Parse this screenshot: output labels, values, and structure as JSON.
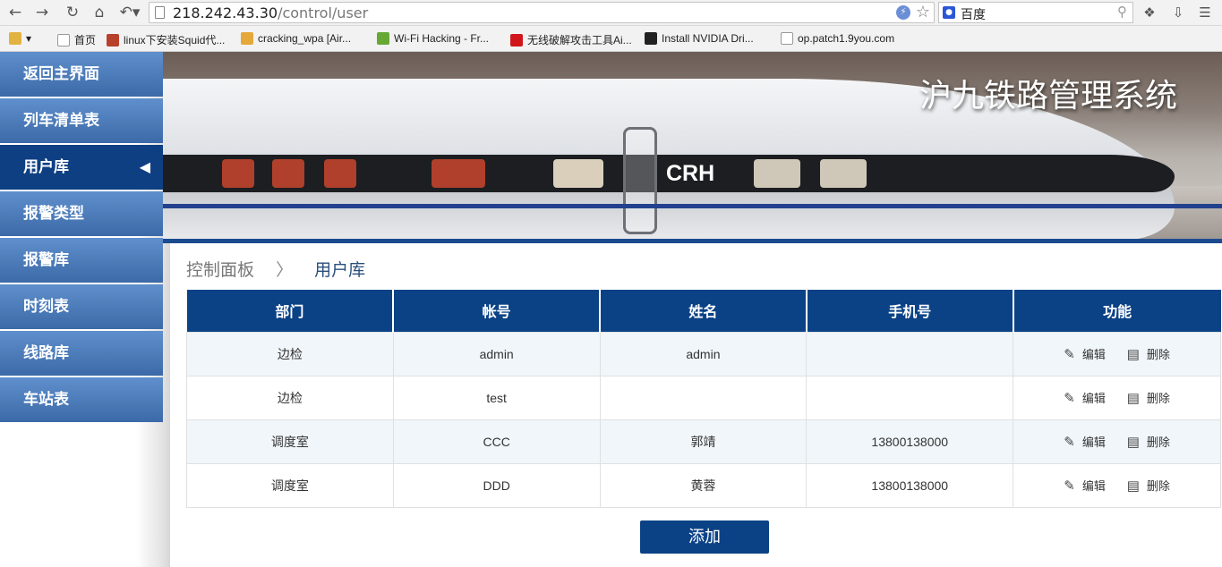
{
  "browser": {
    "url_host": "218.242.43.30",
    "url_path": "/control/user",
    "search_engine": "百度",
    "bookmarks": [
      {
        "label": "首页",
        "color": "#ffffff"
      },
      {
        "label": "linux下安装Squid代...",
        "color": "#b8412b"
      },
      {
        "label": "cracking_wpa [Air...",
        "color": "#e5a83a"
      },
      {
        "label": "Wi-Fi Hacking - Fr...",
        "color": "#66a834"
      },
      {
        "label": "无线破解攻击工具Ai...",
        "color": "#d0161b"
      },
      {
        "label": "Install NVIDIA Dri...",
        "color": "#222222"
      },
      {
        "label": "op.patch1.9you.com",
        "color": "#ffffff"
      }
    ]
  },
  "sidebar": {
    "items": [
      {
        "label": "返回主界面"
      },
      {
        "label": "列车清单表"
      },
      {
        "label": "用户库",
        "active": true
      },
      {
        "label": "报警类型"
      },
      {
        "label": "报警库"
      },
      {
        "label": "时刻表"
      },
      {
        "label": "线路库"
      },
      {
        "label": "车站表"
      }
    ]
  },
  "banner": {
    "title": "沪九铁路管理系统",
    "train_logo": "CRH"
  },
  "breadcrumb": {
    "root": "控制面板",
    "current": "用户库"
  },
  "table": {
    "headers": [
      "部门",
      "帐号",
      "姓名",
      "手机号",
      "功能"
    ],
    "rows": [
      {
        "dept": "边检",
        "account": "admin",
        "name": "admin",
        "phone": ""
      },
      {
        "dept": "边检",
        "account": "test",
        "name": "",
        "phone": ""
      },
      {
        "dept": "调度室",
        "account": "CCC",
        "name": "郭靖",
        "phone": "13800138000"
      },
      {
        "dept": "调度室",
        "account": "DDD",
        "name": "黄蓉",
        "phone": "13800138000"
      }
    ],
    "edit_label": "编辑",
    "delete_label": "删除"
  },
  "add_button": "添加",
  "colors": {
    "header_blue": "#0b4286",
    "sidebar_blue": "#3c6aa8",
    "sidebar_active": "#0e3f82"
  }
}
